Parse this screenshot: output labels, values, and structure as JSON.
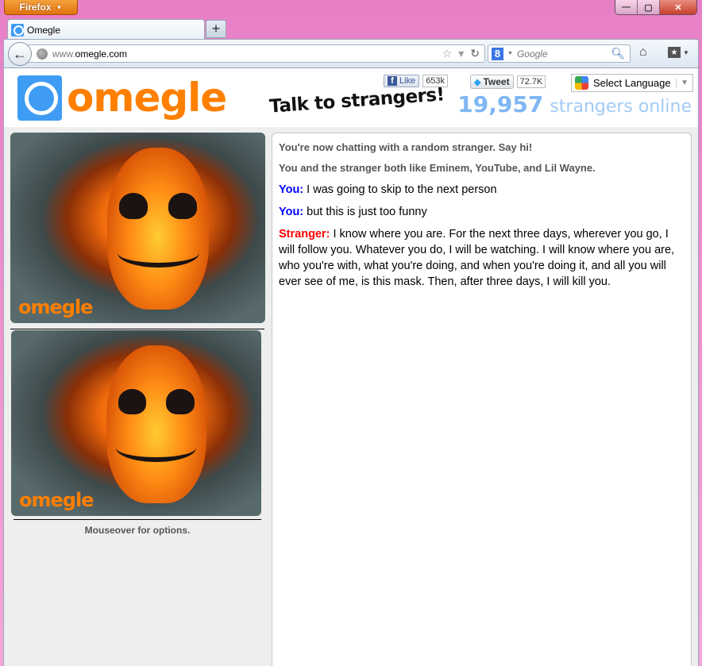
{
  "browser": {
    "app_button_label": "Firefox",
    "window_controls": {
      "minimize": "—",
      "maximize": "▢",
      "close": "✕"
    },
    "tab": {
      "title": "Omegle",
      "icon": "omegle-favicon"
    },
    "new_tab_label": "+",
    "url": {
      "prefix": "www.",
      "domain": "omegle.com"
    },
    "search": {
      "engine_icon": "8",
      "placeholder": "Google"
    },
    "icons": {
      "back": "←",
      "star": "☆",
      "dropdown": "▾",
      "reload": "↻",
      "magnifier": "⚲",
      "home": "⌂",
      "bookmarks": "★"
    }
  },
  "header": {
    "logo_text": "omegle",
    "tagline": "Talk to strangers!",
    "facebook": {
      "label": "Like",
      "count": "653k"
    },
    "twitter": {
      "label": "Tweet",
      "count": "72.7K"
    },
    "language_select": {
      "selected": "Select Language",
      "arrow": "▼"
    },
    "online": {
      "count": "19,957",
      "label": "strangers online"
    }
  },
  "videos": {
    "stranger_watermark": "omegle",
    "self_watermark": "omegle",
    "hint": "Mouseover for options."
  },
  "chat": {
    "system_messages": [
      "You're now chatting with a random stranger. Say hi!",
      "You and the stranger both like Eminem, YouTube, and Lil Wayne."
    ],
    "messages": [
      {
        "sender": "You:",
        "role": "you",
        "text": "I was going to skip to the next person"
      },
      {
        "sender": "You:",
        "role": "you",
        "text": "but this is just too funny"
      },
      {
        "sender": "Stranger:",
        "role": "stranger",
        "text": "I know where you are. For the next three days, wherever you go, I will follow you. Whatever you do, I will be watching. I will know where you are, who you're with, what you're doing, and when you're doing it, and all you will ever see of me, is this mask. Then, after three days, I will kill you."
      }
    ],
    "colors": {
      "you": "#0000ff",
      "stranger": "#ff0000",
      "system": "#555555"
    }
  },
  "colors": {
    "brand_orange": "#ff7f00",
    "brand_blue": "#3f9cf4",
    "online_blue": "#7fb6f3"
  }
}
